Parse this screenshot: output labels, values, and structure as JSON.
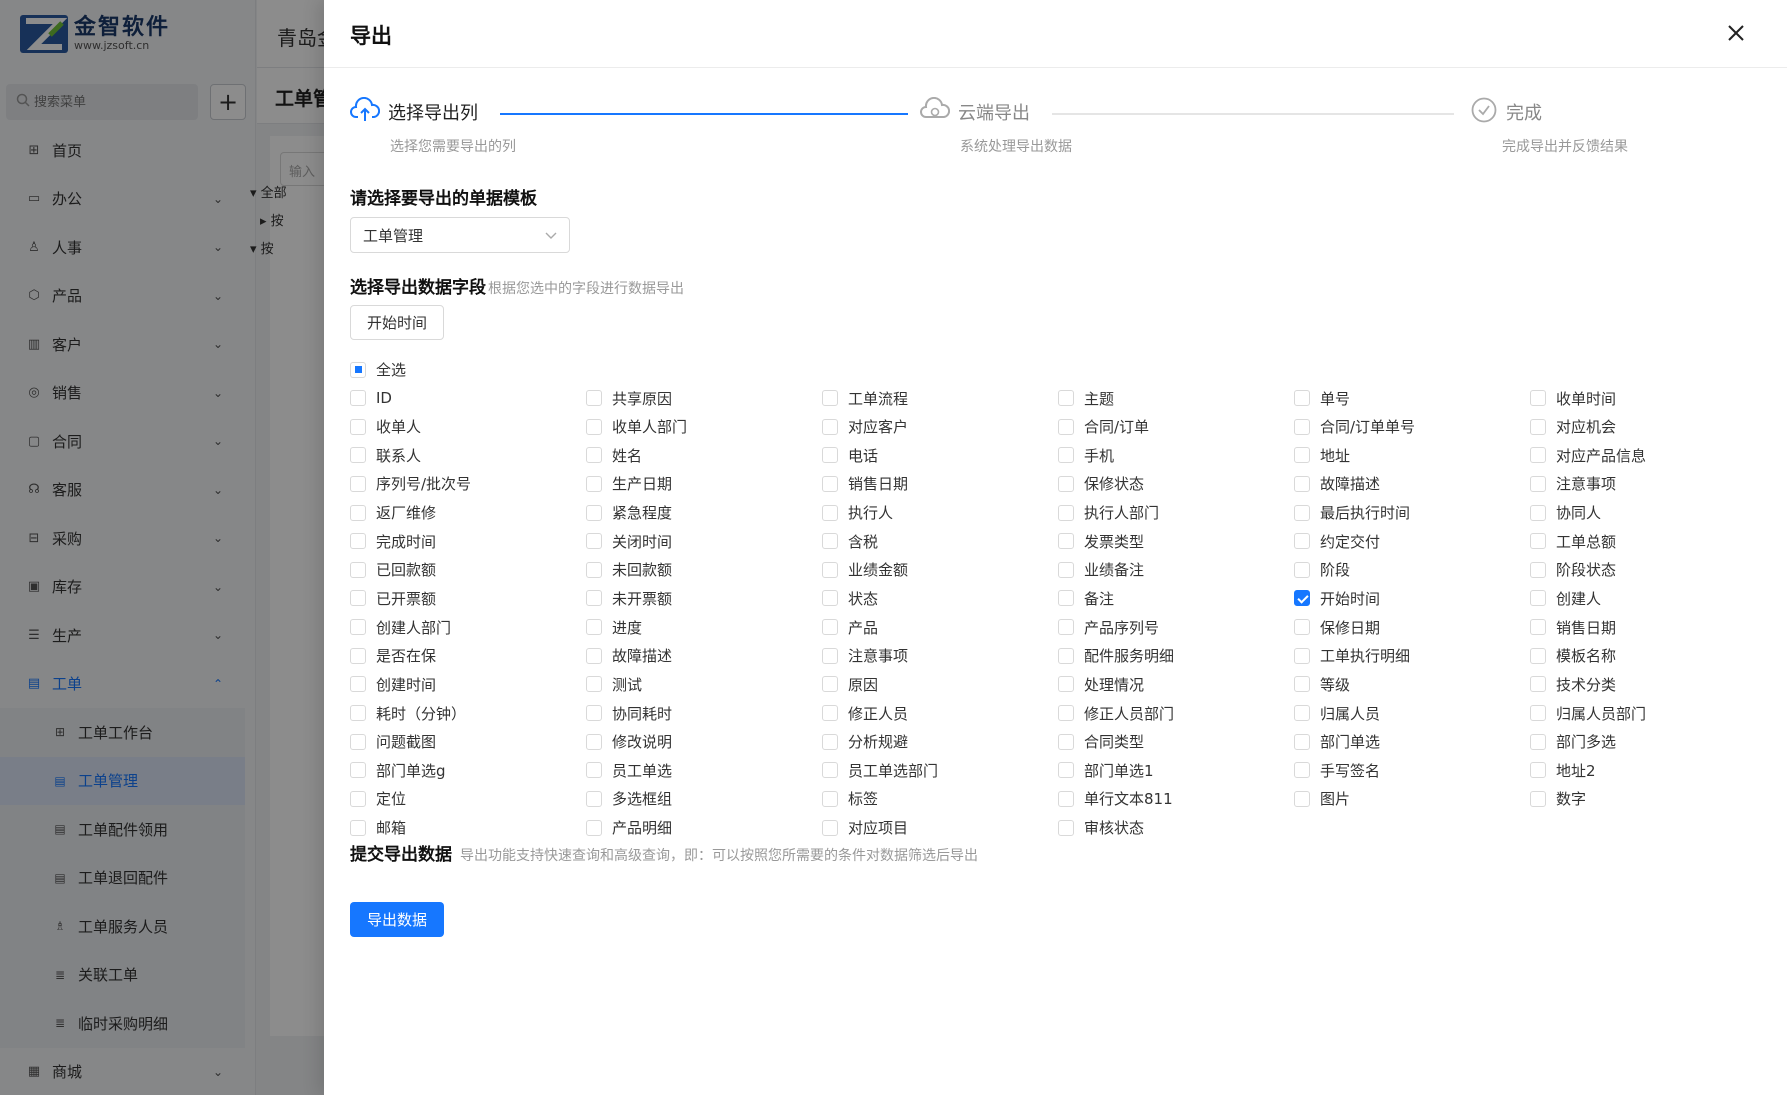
{
  "app": {
    "brand_name": "金智软件",
    "brand_url": "www.jzsoft.cn",
    "company_name": "青岛金",
    "search_placeholder": "搜索菜单",
    "add_label": "+",
    "page_title": "工单管",
    "tree_input_placeholder": "输入",
    "tree_nodes": [
      "全部",
      "按",
      "按"
    ],
    "nav": [
      {
        "icon": "grid-icon",
        "label": "首页",
        "has_children": false
      },
      {
        "icon": "monitor-icon",
        "label": "办公",
        "has_children": true
      },
      {
        "icon": "user-icon",
        "label": "人事",
        "has_children": true
      },
      {
        "icon": "box-icon",
        "label": "产品",
        "has_children": true
      },
      {
        "icon": "customer-icon",
        "label": "客户",
        "has_children": true
      },
      {
        "icon": "sales-icon",
        "label": "销售",
        "has_children": true
      },
      {
        "icon": "contract-icon",
        "label": "合同",
        "has_children": true
      },
      {
        "icon": "service-icon",
        "label": "客服",
        "has_children": true
      },
      {
        "icon": "cart-icon",
        "label": "采购",
        "has_children": true
      },
      {
        "icon": "warehouse-icon",
        "label": "库存",
        "has_children": true
      },
      {
        "icon": "production-icon",
        "label": "生产",
        "has_children": true
      }
    ],
    "active_nav": {
      "icon": "document-icon",
      "label": "工单"
    },
    "sub_nav": [
      {
        "icon": "grid-icon",
        "label": "工单工作台",
        "active": false
      },
      {
        "icon": "document-icon",
        "label": "工单管理",
        "active": true
      },
      {
        "icon": "document-icon",
        "label": "工单配件领用",
        "active": false
      },
      {
        "icon": "document-icon",
        "label": "工单退回配件",
        "active": false
      },
      {
        "icon": "people-icon",
        "label": "工单服务人员",
        "active": false
      },
      {
        "icon": "list-icon",
        "label": "关联工单",
        "active": false
      },
      {
        "icon": "list-icon",
        "label": "临时采购明细",
        "active": false
      }
    ],
    "last_nav": {
      "icon": "shop-icon",
      "label": "商城"
    }
  },
  "drawer": {
    "title": "导出",
    "steps": [
      {
        "title": "选择导出列",
        "desc": "选择您需要导出的列",
        "status": "process",
        "icon": "cloud-upload-icon"
      },
      {
        "title": "云端导出",
        "desc": "系统处理导出数据",
        "status": "wait",
        "icon": "cloud-sync-icon"
      },
      {
        "title": "完成",
        "desc": "完成导出并反馈结果",
        "status": "wait",
        "icon": "check-circle-icon"
      }
    ],
    "template_section_title": "请选择要导出的单据模板",
    "template_value": "工单管理",
    "fields_section_title": "选择导出数据字段",
    "fields_section_hint": "根据您选中的字段进行数据导出",
    "selected_field_tag": "开始时间",
    "select_all_label": "全选",
    "fields": [
      {
        "label": "ID",
        "checked": false
      },
      {
        "label": "共享原因",
        "checked": false
      },
      {
        "label": "工单流程",
        "checked": false
      },
      {
        "label": "主题",
        "checked": false
      },
      {
        "label": "单号",
        "checked": false
      },
      {
        "label": "收单时间",
        "checked": false
      },
      {
        "label": "收单人",
        "checked": false
      },
      {
        "label": "收单人部门",
        "checked": false
      },
      {
        "label": "对应客户",
        "checked": false
      },
      {
        "label": "合同/订单",
        "checked": false
      },
      {
        "label": "合同/订单单号",
        "checked": false
      },
      {
        "label": "对应机会",
        "checked": false
      },
      {
        "label": "联系人",
        "checked": false
      },
      {
        "label": "姓名",
        "checked": false
      },
      {
        "label": "电话",
        "checked": false
      },
      {
        "label": "手机",
        "checked": false
      },
      {
        "label": "地址",
        "checked": false
      },
      {
        "label": "对应产品信息",
        "checked": false
      },
      {
        "label": "序列号/批次号",
        "checked": false
      },
      {
        "label": "生产日期",
        "checked": false
      },
      {
        "label": "销售日期",
        "checked": false
      },
      {
        "label": "保修状态",
        "checked": false
      },
      {
        "label": "故障描述",
        "checked": false
      },
      {
        "label": "注意事项",
        "checked": false
      },
      {
        "label": "返厂维修",
        "checked": false
      },
      {
        "label": "紧急程度",
        "checked": false
      },
      {
        "label": "执行人",
        "checked": false
      },
      {
        "label": "执行人部门",
        "checked": false
      },
      {
        "label": "最后执行时间",
        "checked": false
      },
      {
        "label": "协同人",
        "checked": false
      },
      {
        "label": "完成时间",
        "checked": false
      },
      {
        "label": "关闭时间",
        "checked": false
      },
      {
        "label": "含税",
        "checked": false
      },
      {
        "label": "发票类型",
        "checked": false
      },
      {
        "label": "约定交付",
        "checked": false
      },
      {
        "label": "工单总额",
        "checked": false
      },
      {
        "label": "已回款额",
        "checked": false
      },
      {
        "label": "未回款额",
        "checked": false
      },
      {
        "label": "业绩金额",
        "checked": false
      },
      {
        "label": "业绩备注",
        "checked": false
      },
      {
        "label": "阶段",
        "checked": false
      },
      {
        "label": "阶段状态",
        "checked": false
      },
      {
        "label": "已开票额",
        "checked": false
      },
      {
        "label": "未开票额",
        "checked": false
      },
      {
        "label": "状态",
        "checked": false
      },
      {
        "label": "备注",
        "checked": false
      },
      {
        "label": "开始时间",
        "checked": true
      },
      {
        "label": "创建人",
        "checked": false
      },
      {
        "label": "创建人部门",
        "checked": false
      },
      {
        "label": "进度",
        "checked": false
      },
      {
        "label": "产品",
        "checked": false
      },
      {
        "label": "产品序列号",
        "checked": false
      },
      {
        "label": "保修日期",
        "checked": false
      },
      {
        "label": "销售日期",
        "checked": false
      },
      {
        "label": "是否在保",
        "checked": false
      },
      {
        "label": "故障描述",
        "checked": false
      },
      {
        "label": "注意事项",
        "checked": false
      },
      {
        "label": "配件服务明细",
        "checked": false
      },
      {
        "label": "工单执行明细",
        "checked": false
      },
      {
        "label": "模板名称",
        "checked": false
      },
      {
        "label": "创建时间",
        "checked": false
      },
      {
        "label": "测试",
        "checked": false
      },
      {
        "label": "原因",
        "checked": false
      },
      {
        "label": "处理情况",
        "checked": false
      },
      {
        "label": "等级",
        "checked": false
      },
      {
        "label": "技术分类",
        "checked": false
      },
      {
        "label": "耗时（分钟）",
        "checked": false
      },
      {
        "label": "协同耗时",
        "checked": false
      },
      {
        "label": "修正人员",
        "checked": false
      },
      {
        "label": "修正人员部门",
        "checked": false
      },
      {
        "label": "归属人员",
        "checked": false
      },
      {
        "label": "归属人员部门",
        "checked": false
      },
      {
        "label": "问题截图",
        "checked": false
      },
      {
        "label": "修改说明",
        "checked": false
      },
      {
        "label": "分析规避",
        "checked": false
      },
      {
        "label": "合同类型",
        "checked": false
      },
      {
        "label": "部门单选",
        "checked": false
      },
      {
        "label": "部门多选",
        "checked": false
      },
      {
        "label": "部门单选g",
        "checked": false
      },
      {
        "label": "员工单选",
        "checked": false
      },
      {
        "label": "员工单选部门",
        "checked": false
      },
      {
        "label": "部门单选1",
        "checked": false
      },
      {
        "label": "手写签名",
        "checked": false
      },
      {
        "label": "地址2",
        "checked": false
      },
      {
        "label": "定位",
        "checked": false
      },
      {
        "label": "多选框组",
        "checked": false
      },
      {
        "label": "标签",
        "checked": false
      },
      {
        "label": "单行文本811",
        "checked": false
      },
      {
        "label": "图片",
        "checked": false
      },
      {
        "label": "数字",
        "checked": false
      },
      {
        "label": "邮箱",
        "checked": false
      },
      {
        "label": "产品明细",
        "checked": false
      },
      {
        "label": "对应项目",
        "checked": false
      },
      {
        "label": "审核状态",
        "checked": false
      }
    ],
    "submit_section_title": "提交导出数据",
    "submit_section_hint": "导出功能支持快速查询和高级查询，即：可以按照您所需要的条件对数据筛选后导出",
    "export_button_label": "导出数据",
    "colors": {
      "primary": "#1677ff",
      "muted": "#999999"
    }
  }
}
